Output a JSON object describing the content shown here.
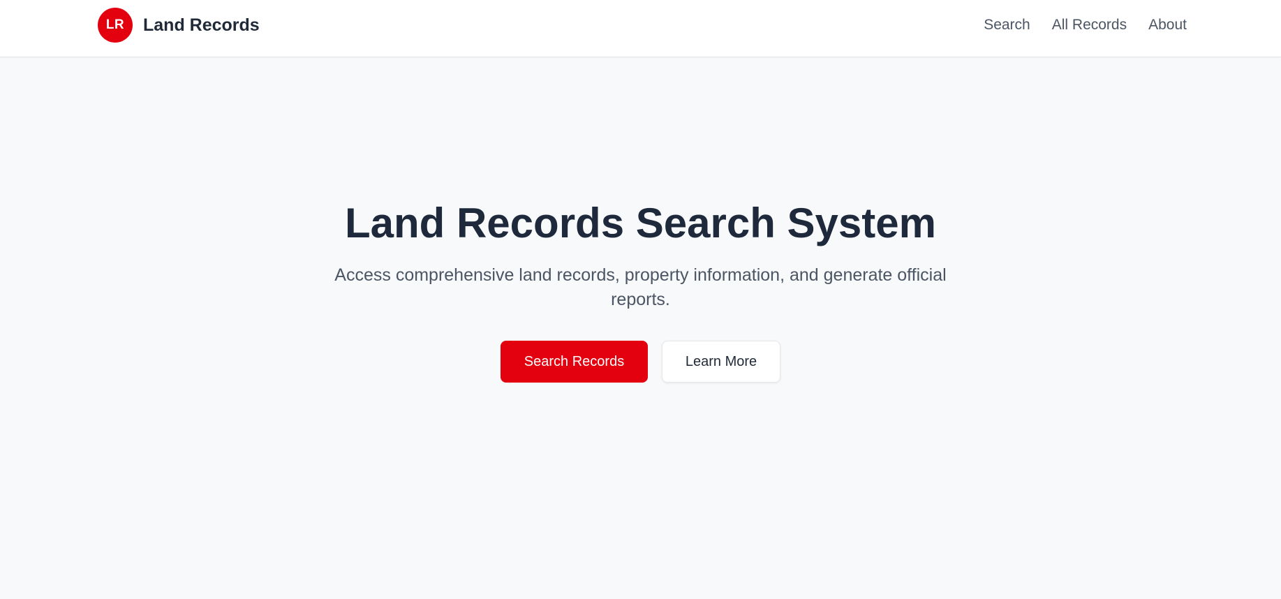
{
  "header": {
    "logo_initials": "LR",
    "brand_name": "Land Records",
    "nav": {
      "search": "Search",
      "all_records": "All Records",
      "about": "About"
    }
  },
  "hero": {
    "title": "Land Records Search System",
    "subtitle": "Access comprehensive land records, property information, and generate official reports.",
    "primary_button": "Search Records",
    "secondary_button": "Learn More"
  },
  "colors": {
    "brand": "#e3000f",
    "background": "#f8f9fb",
    "header_background": "#ffffff",
    "title_text": "#1e293b",
    "body_text": "#4b5563"
  }
}
